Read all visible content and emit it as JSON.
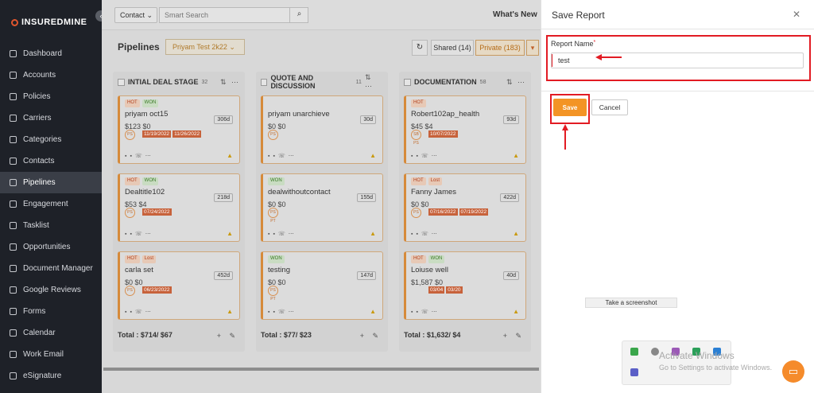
{
  "app": {
    "logo_text_a": "INSUREDMINE",
    "collapse_icon": "chevron-left-icon"
  },
  "sidebar": {
    "items": [
      {
        "label": "Dashboard",
        "icon": "dashboard-icon"
      },
      {
        "label": "Accounts",
        "icon": "accounts-icon"
      },
      {
        "label": "Policies",
        "icon": "policies-icon"
      },
      {
        "label": "Carriers",
        "icon": "carriers-icon"
      },
      {
        "label": "Categories",
        "icon": "categories-icon"
      },
      {
        "label": "Contacts",
        "icon": "contacts-icon"
      },
      {
        "label": "Pipelines",
        "icon": "pipelines-icon",
        "active": true
      },
      {
        "label": "Engagement",
        "icon": "engagement-icon"
      },
      {
        "label": "Tasklist",
        "icon": "tasklist-icon"
      },
      {
        "label": "Opportunities",
        "icon": "opportunities-icon"
      },
      {
        "label": "Document Manager",
        "icon": "document-icon"
      },
      {
        "label": "Google Reviews",
        "icon": "google-icon"
      },
      {
        "label": "Forms",
        "icon": "forms-icon"
      },
      {
        "label": "Calendar",
        "icon": "calendar-icon"
      },
      {
        "label": "Work Email",
        "icon": "email-icon"
      },
      {
        "label": "eSignature",
        "icon": "signature-icon"
      }
    ]
  },
  "topbar": {
    "contact_type": "Contact ⌄",
    "search_placeholder": "Smart Search",
    "whats_new": "What's New"
  },
  "pipeline": {
    "title": "Pipelines",
    "selected": "Priyam Test 2k22 ⌄",
    "shared": "Shared (14)",
    "private": "Private (183)"
  },
  "columns": [
    {
      "title": "INTIAL DEAL STAGE",
      "count": "32",
      "total": "Total : $714/ $67",
      "cards": [
        {
          "tags": [
            "HOT",
            "WON"
          ],
          "name": "priyam oct15",
          "money": "$123  $0",
          "age": "306d",
          "avatar": "PS",
          "dates": [
            "11/19/2022",
            "11/26/2022"
          ]
        },
        {
          "tags": [
            "HOT",
            "WON"
          ],
          "name": "Dealtitle102",
          "money": "$53  $4",
          "age": "218d",
          "avatar": "PS",
          "dates": [
            "07/24/2022"
          ]
        },
        {
          "tags": [
            "HOT",
            "Lost"
          ],
          "name": "carla set",
          "money": "$0  $0",
          "age": "452d",
          "avatar": "PS",
          "dates": [
            "06/23/2022"
          ]
        }
      ]
    },
    {
      "title": "QUOTE AND DISCUSSION",
      "count": "11",
      "total": "Total : $77/ $23",
      "cards": [
        {
          "tags": [],
          "name": "priyam unarchieve",
          "money": "$0  $0",
          "age": "30d",
          "avatar": "PS",
          "dates": []
        },
        {
          "tags": [
            "WON"
          ],
          "name": "dealwithoutcontact",
          "money": "$0  $0",
          "age": "155d",
          "avatar": "PS PT",
          "dates": []
        },
        {
          "tags": [
            "WON"
          ],
          "name": "testing",
          "money": "$0  $0",
          "age": "147d",
          "avatar": "PS PT",
          "dates": []
        }
      ]
    },
    {
      "title": "DOCUMENTATION",
      "count": "58",
      "total": "Total : $1,632/ $4",
      "cards": [
        {
          "tags": [
            "HOT"
          ],
          "name": "Robert102ap_health",
          "money": "$45  $4",
          "age": "93d",
          "avatar": "SB PS",
          "dates": [
            "10/07/2022"
          ]
        },
        {
          "tags": [
            "HOT",
            "Lost"
          ],
          "name": "Fanny James",
          "money": "$0  $0",
          "age": "422d",
          "avatar": "PS",
          "dates": [
            "07/16/2022",
            "07/19/2022"
          ]
        },
        {
          "tags": [
            "HOT",
            "WON"
          ],
          "name": "Loiuse well",
          "money": "$1,587  $0",
          "age": "40d",
          "avatar": "",
          "dates": [
            "03/04",
            "03/20"
          ]
        }
      ]
    }
  ],
  "modal": {
    "title": "Save Report",
    "close_icon": "close-icon",
    "field_label": "Report Name",
    "required_mark": "*",
    "field_value": "test",
    "save_label": "Save",
    "cancel_label": "Cancel"
  },
  "overlay": {
    "screenshot_tip": "Take a screenshot",
    "activate_title": "Activate Windows",
    "activate_sub": "Go to Settings to activate Windows."
  },
  "colors": {
    "accent": "#f39425",
    "annotation_red": "#e21b23",
    "sidebar_bg": "#1e2128"
  }
}
